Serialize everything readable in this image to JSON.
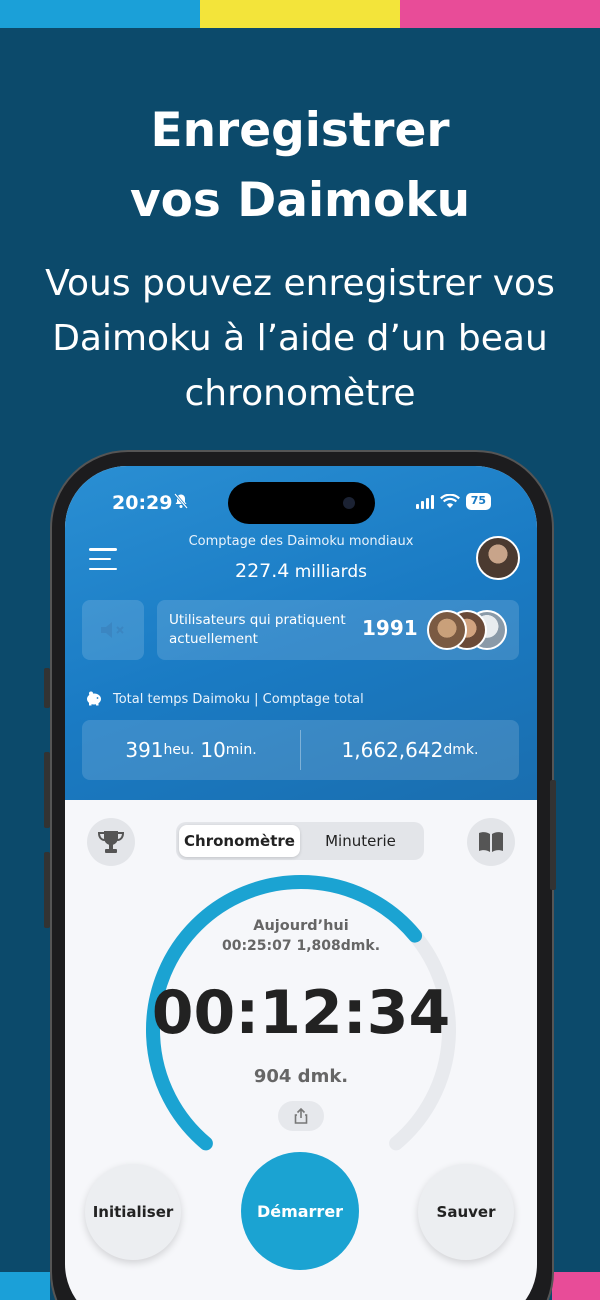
{
  "banner": {
    "title_line1": "Enregistrer",
    "title_line2": "vos Daimoku",
    "subtitle_line1": "Vous pouvez enregistrer vos",
    "subtitle_line2": "Daimoku à l’aide d’un beau",
    "subtitle_line3": "chronomètre"
  },
  "colors": {
    "background": "#0c4a6b",
    "bar_blue": "#1ba0d8",
    "bar_yellow": "#f3e43a",
    "bar_pink": "#e84c98",
    "accent": "#1ba3d2"
  },
  "status_bar": {
    "time": "20:29",
    "battery": "75",
    "icons": [
      "bell-slash-icon",
      "signal-icon",
      "wifi-icon",
      "battery-icon"
    ]
  },
  "header": {
    "global_label": "Comptage des Daimoku mondiaux",
    "global_value": "227.4",
    "global_unit": "milliards"
  },
  "users": {
    "label": "Utilisateurs qui pratiquent actuellement",
    "count": "1991"
  },
  "totals": {
    "label": "Total temps Daimoku | Comptage total",
    "hours_value": "391",
    "hours_unit": "heu.",
    "minutes_value": "10",
    "minutes_unit": "min.",
    "count_value": "1,662,642",
    "count_unit": "dmk."
  },
  "tabs": {
    "stopwatch": "Chronomètre",
    "timer": "Minuterie"
  },
  "today": {
    "label": "Aujourd’hui",
    "value": "00:25:07 1,808dmk."
  },
  "stopwatch": {
    "time": "00:12:34",
    "count": "904 dmk.",
    "progress": 0.68
  },
  "buttons": {
    "reset": "Initialiser",
    "start": "Démarrer",
    "save": "Sauver"
  }
}
